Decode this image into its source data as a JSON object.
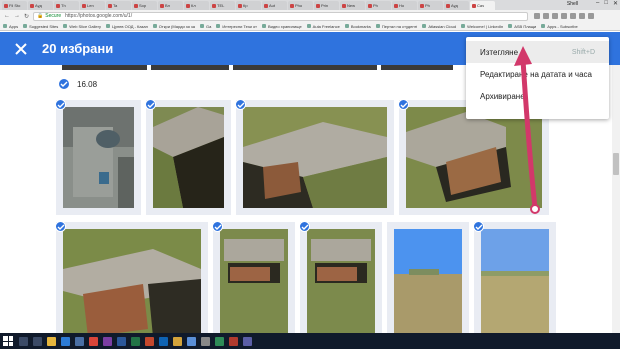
{
  "browser": {
    "tabs": [
      {
        "label": "Fil Sto",
        "active": false
      },
      {
        "label": "Ауд",
        "active": false
      },
      {
        "label": "Th",
        "active": false
      },
      {
        "label": "Len",
        "active": false
      },
      {
        "label": "Ta",
        "active": false
      },
      {
        "label": "Sop",
        "active": false
      },
      {
        "label": "Вл",
        "active": false
      },
      {
        "label": "Кл",
        "active": false
      },
      {
        "label": "TEL",
        "active": false
      },
      {
        "label": "Кр",
        "active": false
      },
      {
        "label": "Aut",
        "active": false
      },
      {
        "label": "Pho",
        "active": false
      },
      {
        "label": "Prin",
        "active": false
      },
      {
        "label": "New",
        "active": false
      },
      {
        "label": "Ph",
        "active": false
      },
      {
        "label": "Ho",
        "active": false
      },
      {
        "label": "Ph",
        "active": false
      },
      {
        "label": "Ауд",
        "active": false
      },
      {
        "label": "Сач",
        "active": true
      }
    ],
    "user": "Shell",
    "url": "https://photos.google.com/u/1/",
    "secure_label": "Secure",
    "bookmarks": [
      "Apps",
      "Suggested Sites",
      "Web Slice Gallery",
      "Цунев ООД - Казан",
      "Откри (Марди зя за",
      "Ga",
      "Интересни Тези от",
      "Видео хранилище",
      "Auta Freelance",
      "Bookmarks",
      "Пертал на студенті",
      "Atlassian Cloud",
      "Welcome! | LinkedIn",
      "ASB Плащи",
      "Apps - Subscribe"
    ]
  },
  "header": {
    "close_icon": "close-icon",
    "selected_count": "20 избрани"
  },
  "content": {
    "date_label": "16.08"
  },
  "menu": {
    "items": [
      {
        "label": "Изтегляне",
        "shortcut": "Shift+D"
      },
      {
        "label": "Редактиране на датата и часа",
        "shortcut": ""
      },
      {
        "label": "Архивиране",
        "shortcut": ""
      }
    ]
  },
  "colors": {
    "header_blue": "#2f73de",
    "annotation_arrow": "#d2386a"
  }
}
